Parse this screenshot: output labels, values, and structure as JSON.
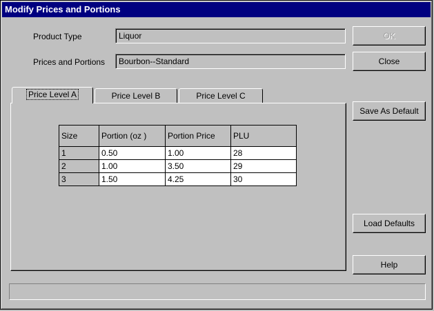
{
  "window": {
    "title": "Modify Prices and Portions"
  },
  "form": {
    "product_type_label": "Product Type",
    "product_type_value": "Liquor",
    "prices_portions_label": "Prices and Portions",
    "prices_portions_value": "Bourbon--Standard"
  },
  "buttons": {
    "ok": "OK",
    "close": "Close",
    "save_as_default": "Save As Default",
    "load_defaults": "Load Defaults",
    "help": "Help"
  },
  "tabs": [
    {
      "label": "Price Level A",
      "active": true
    },
    {
      "label": "Price Level B",
      "active": false
    },
    {
      "label": "Price Level C",
      "active": false
    }
  ],
  "table": {
    "headers": [
      "Size",
      "Portion (oz )",
      "Portion Price",
      "PLU"
    ],
    "rows": [
      [
        "1",
        "0.50",
        "1.00",
        "28"
      ],
      [
        "2",
        "1.00",
        "3.50",
        "29"
      ],
      [
        "3",
        "1.50",
        "4.25",
        "30"
      ]
    ]
  },
  "status_bar": {
    "text": ""
  }
}
